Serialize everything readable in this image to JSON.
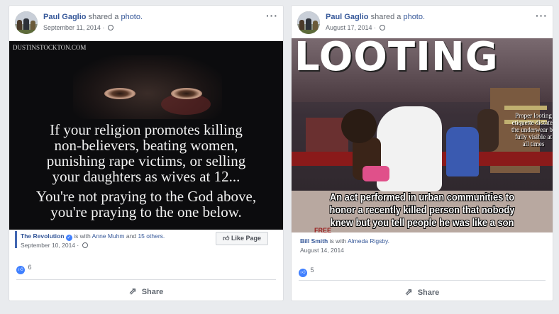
{
  "posts": [
    {
      "author": "Paul Gaglio",
      "verb": "shared a",
      "object": "photo.",
      "date": "September 11, 2014 ·",
      "more": "···",
      "image": {
        "watermark": "DUSTINSTOCKTON.COM",
        "lines": [
          "If your religion promotes killing",
          "non-believers, beating women,",
          "punishing rape victims, or selling",
          "your daughters as wives at 12...",
          "You're not praying to the God above,",
          "you're praying to the one below."
        ]
      },
      "attribution": {
        "page": "The Revolution",
        "with_text": "is with",
        "with_name": "Anne Muhm",
        "and_text": "and",
        "others": "15 others.",
        "date": "September 10, 2014 ·",
        "like_page_button": "Like Page"
      },
      "reactions_count": "6",
      "share_label": "Share"
    },
    {
      "author": "Paul Gaglio",
      "verb": "shared a",
      "object": "photo.",
      "date": "August 17, 2014 ·",
      "more": "···",
      "image": {
        "headline": "LOOTING",
        "side_note": "Proper looting etiquette dictates the underwear be fully visible at all times",
        "caption_lines": [
          "An act performed in urban communities to",
          "honor a recently killed person that nobody",
          "knew but you tell people he was like a son"
        ],
        "sign": "FREE"
      },
      "attribution": {
        "page": "Bill Smith",
        "with_text": "is with",
        "with_name": "Almeda Rigsby.",
        "date": "August 14, 2014"
      },
      "reactions_count": "5",
      "share_label": "Share"
    }
  ],
  "colors": {
    "link": "#365899",
    "like_blue": "#4080ff",
    "background": "#e9ebee"
  }
}
